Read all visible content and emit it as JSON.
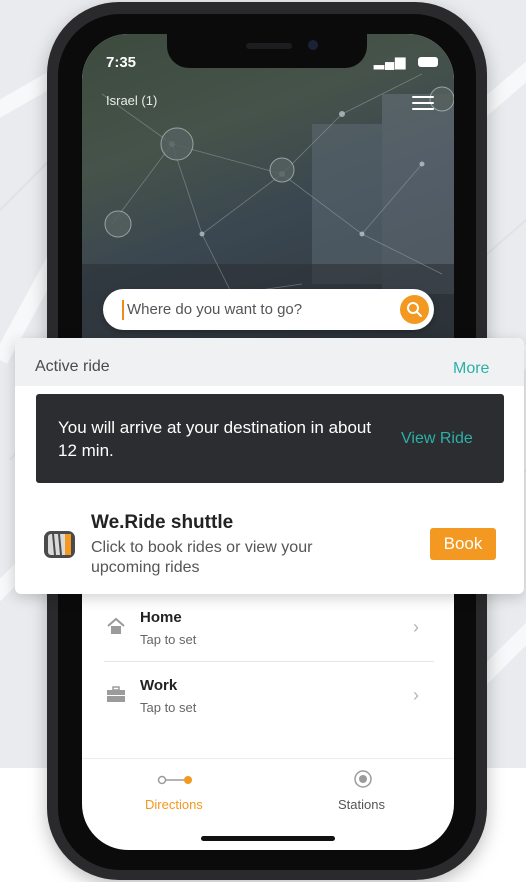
{
  "status_bar": {
    "time": "7:35",
    "signal": "▂▄▆"
  },
  "header": {
    "region": "Israel (1)"
  },
  "search": {
    "placeholder": "Where do you want to go?"
  },
  "active_ride": {
    "title": "Active ride",
    "more_label": "More",
    "message": "You will arrive at your destination in about 12 min.",
    "view_ride_label": "View Ride"
  },
  "shuttle": {
    "title": "We.Ride shuttle",
    "subtitle": "Click to book rides or view your upcoming rides",
    "book_label": "Book"
  },
  "places": [
    {
      "title": "Home",
      "subtitle": "Tap to set",
      "icon": "home-icon"
    },
    {
      "title": "Work",
      "subtitle": "Tap to set",
      "icon": "briefcase-icon"
    }
  ],
  "tabs": [
    {
      "label": "Directions",
      "icon": "directions-icon",
      "active": true
    },
    {
      "label": "Stations",
      "icon": "stations-icon",
      "active": false
    }
  ],
  "colors": {
    "accent": "#f39820",
    "teal": "#2ab1a8"
  }
}
